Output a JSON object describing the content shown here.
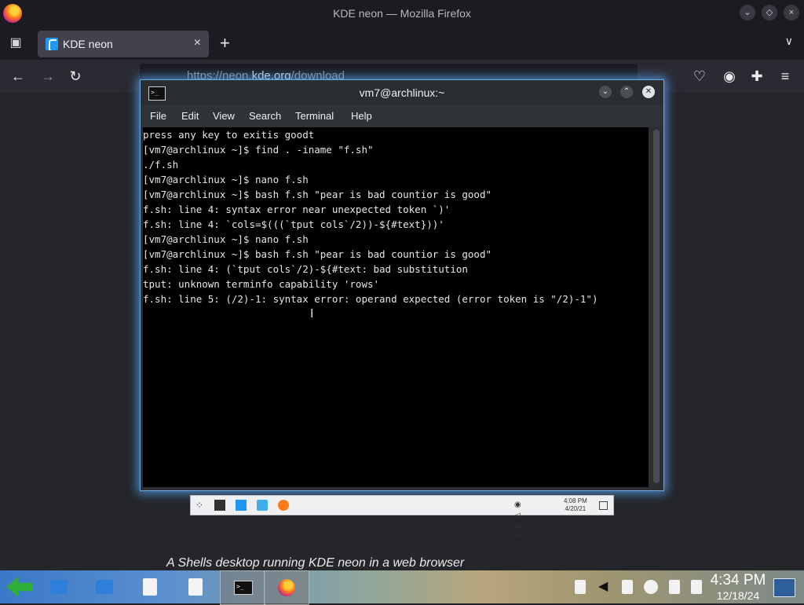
{
  "firefox": {
    "window_title": "KDE neon — Mozilla Firefox",
    "tab": {
      "label": "KDE neon",
      "close": "×"
    },
    "new_tab": "+",
    "url_prefix": "https://neon.",
    "url_domain": "kde.org",
    "url_path": "/download",
    "caption": "A Shells desktop running KDE neon in a web browser"
  },
  "konsole": {
    "title": "vm7@archlinux:~",
    "menu": [
      "File",
      "Edit",
      "View",
      "Search",
      "Terminal",
      "Help"
    ],
    "lines": [
      "press any key to exitis goodt",
      "[vm7@archlinux ~]$ find . -iname \"f.sh\"",
      "./f.sh",
      "[vm7@archlinux ~]$ nano f.sh",
      "[vm7@archlinux ~]$ bash f.sh \"pear is bad countior is good\"",
      "f.sh: line 4: syntax error near unexpected token `)'",
      "f.sh: line 4: `cols=$(((`tput cols`/2))-${#text}))'",
      "[vm7@archlinux ~]$ nano f.sh",
      "[vm7@archlinux ~]$ bash f.sh \"pear is bad countior is good\"",
      "f.sh: line 4: (`tput cols`/2)-${#text: bad substitution",
      "tput: unknown terminfo capability 'rows'",
      "f.sh: line 5: (/2)-1: syntax error: operand expected (error token is \"/2)-1\")"
    ]
  },
  "remote_panel": {
    "time": "4:08 PM",
    "date": "4/20/21"
  },
  "taskbar": {
    "time": "4:34 PM",
    "date": "12/18/24"
  },
  "colors": {
    "accent_glow": "#5aaaff",
    "taskbar_start": "#2fae3a"
  }
}
